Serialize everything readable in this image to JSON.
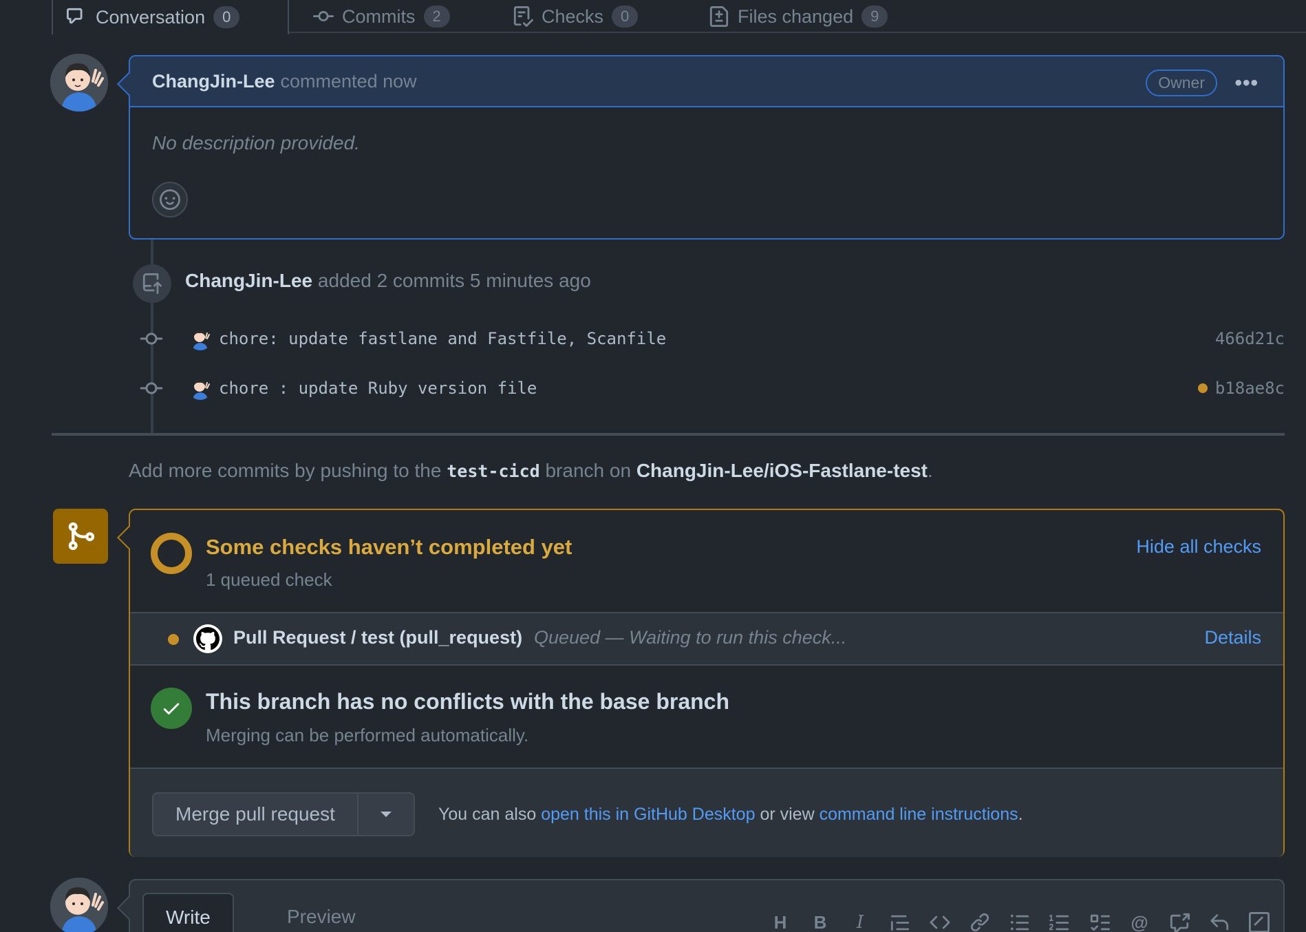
{
  "tabs": [
    {
      "label": "Conversation",
      "count": "0",
      "icon": "comment-discussion-icon"
    },
    {
      "label": "Commits",
      "count": "2",
      "icon": "git-commit-icon"
    },
    {
      "label": "Checks",
      "count": "0",
      "icon": "checklist-icon"
    },
    {
      "label": "Files changed",
      "count": "9",
      "icon": "file-diff-icon"
    }
  ],
  "comment": {
    "author": "ChangJin-Lee",
    "action": "commented now",
    "badge": "Owner",
    "body": "No description provided."
  },
  "commits_event": {
    "author": "ChangJin-Lee",
    "text": "added 2 commits 5 minutes ago",
    "commits": [
      {
        "message": "chore: update fastlane and Fastfile, Scanfile",
        "sha": "466d21c"
      },
      {
        "message": "chore : update Ruby version file",
        "sha": "b18ae8c"
      }
    ]
  },
  "push_note": {
    "prefix": "Add more commits by pushing to the",
    "branch": "test-cicd",
    "middle": "branch on",
    "repo": "ChangJin-Lee/iOS-Fastlane-test",
    "suffix": "."
  },
  "checks": {
    "title": "Some checks haven’t completed yet",
    "subtitle": "1 queued check",
    "hide_label": "Hide all checks",
    "items": [
      {
        "name": "Pull Request / test (pull_request)",
        "status": "Queued — Waiting to run this check...",
        "details_label": "Details"
      }
    ]
  },
  "conflicts": {
    "title": "This branch has no conflicts with the base branch",
    "subtitle": "Merging can be performed automatically."
  },
  "merge": {
    "button_label": "Merge pull request",
    "help_prefix": "You can also",
    "desktop_link": "open this in GitHub Desktop",
    "help_middle": "or view",
    "cli_link": "command line instructions",
    "help_suffix": "."
  },
  "editor": {
    "write_tab": "Write",
    "preview_tab": "Preview",
    "tools": [
      "heading-icon",
      "bold-icon",
      "italic-icon",
      "quote-icon",
      "code-icon",
      "link-icon",
      "unordered-list-icon",
      "ordered-list-icon",
      "task-list-icon",
      "mention-icon",
      "cross-reference-icon",
      "reply-icon",
      "slash-command-icon"
    ]
  },
  "colors": {
    "background": "#22272e",
    "accent_blue": "#316dca",
    "link": "#539bf5",
    "pending": "#c69026",
    "success": "#347d39"
  }
}
